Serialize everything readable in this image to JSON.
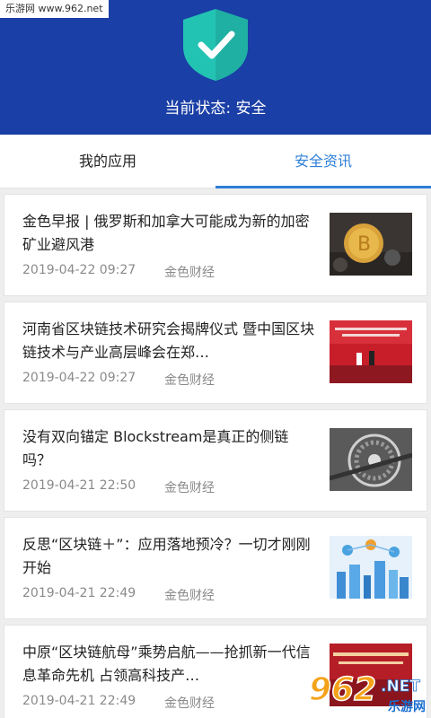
{
  "watermark": "乐游网 www.962.net",
  "header": {
    "status_text": "当前状态: 安全",
    "colors": {
      "background": "#1a3fa6",
      "shield": "#23c3b3"
    }
  },
  "tabs": [
    {
      "label": "我的应用",
      "active": false
    },
    {
      "label": "安全资讯",
      "active": true
    }
  ],
  "news": [
    {
      "title": "金色早报 | 俄罗斯和加拿大可能成为新的加密矿业避风港",
      "date": "2019-04-22 09:27",
      "source": "金色财经",
      "thumbnail": "bitcoin-coin-image"
    },
    {
      "title": "河南省区块链技术研究会揭牌仪式 暨中国区块链技术与产业高层峰会在郑…",
      "date": "2019-04-22 09:27",
      "source": "金色财经",
      "thumbnail": "conference-stage-image"
    },
    {
      "title": "没有双向锚定 Blockstream是真正的侧链吗？",
      "date": "2019-04-21 22:50",
      "source": "金色财经",
      "thumbnail": "bicycle-chain-image"
    },
    {
      "title": "反思“区块链＋”：应用落地预冷？一切才刚刚开始",
      "date": "2019-04-21 22:49",
      "source": "金色财经",
      "thumbnail": "city-network-image"
    },
    {
      "title": "中原“区块链航母”乘势启航——抢抓新一代信息革命先机 占领高科技产…",
      "date": "2019-04-21 22:49",
      "source": "金色财经",
      "thumbnail": "conference-banner-image"
    }
  ],
  "logo": {
    "text": "962",
    "suffix": "NET",
    "subtitle": "乐游网"
  },
  "colors": {
    "accent": "#2d7fd6",
    "meta_text": "#8a8a8a"
  }
}
